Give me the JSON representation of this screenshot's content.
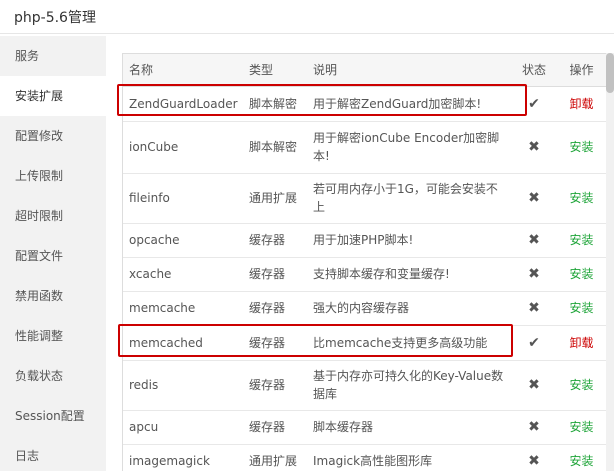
{
  "window": {
    "title": "php-5.6管理"
  },
  "sidebar": {
    "items": [
      {
        "label": "服务"
      },
      {
        "label": "安装扩展"
      },
      {
        "label": "配置修改"
      },
      {
        "label": "上传限制"
      },
      {
        "label": "超时限制"
      },
      {
        "label": "配置文件"
      },
      {
        "label": "禁用函数"
      },
      {
        "label": "性能调整"
      },
      {
        "label": "负载状态"
      },
      {
        "label": "Session配置"
      },
      {
        "label": "日志"
      }
    ],
    "active_index": 1
  },
  "table": {
    "headers": {
      "name": "名称",
      "type": "类型",
      "desc": "说明",
      "status": "状态",
      "action": "操作"
    },
    "rows": [
      {
        "name": "ZendGuardLoader",
        "type": "脚本解密",
        "desc": "用于解密ZendGuard加密脚本!",
        "status": "✔",
        "action": "卸载"
      },
      {
        "name": "ionCube",
        "type": "脚本解密",
        "desc": "用于解密ionCube Encoder加密脚本!",
        "status": "✖",
        "action": "安装"
      },
      {
        "name": "fileinfo",
        "type": "通用扩展",
        "desc": "若可用内存小于1G，可能会安装不上",
        "status": "✖",
        "action": "安装"
      },
      {
        "name": "opcache",
        "type": "缓存器",
        "desc": "用于加速PHP脚本!",
        "status": "✖",
        "action": "安装"
      },
      {
        "name": "xcache",
        "type": "缓存器",
        "desc": "支持脚本缓存和变量缓存!",
        "status": "✖",
        "action": "安装"
      },
      {
        "name": "memcache",
        "type": "缓存器",
        "desc": "强大的内容缓存器",
        "status": "✖",
        "action": "安装"
      },
      {
        "name": "memcached",
        "type": "缓存器",
        "desc": "比memcache支持更多高级功能",
        "status": "✔",
        "action": "卸载"
      },
      {
        "name": "redis",
        "type": "缓存器",
        "desc": "基于内存亦可持久化的Key-Value数据库",
        "status": "✖",
        "action": "安装"
      },
      {
        "name": "apcu",
        "type": "缓存器",
        "desc": "脚本缓存器",
        "status": "✖",
        "action": "安装"
      },
      {
        "name": "imagemagick",
        "type": "通用扩展",
        "desc": "Imagick高性能图形库",
        "status": "✖",
        "action": "安装"
      }
    ]
  },
  "colors": {
    "install": "#20a53a",
    "uninstall": "#cc0000",
    "highlight": "#cc0000"
  }
}
